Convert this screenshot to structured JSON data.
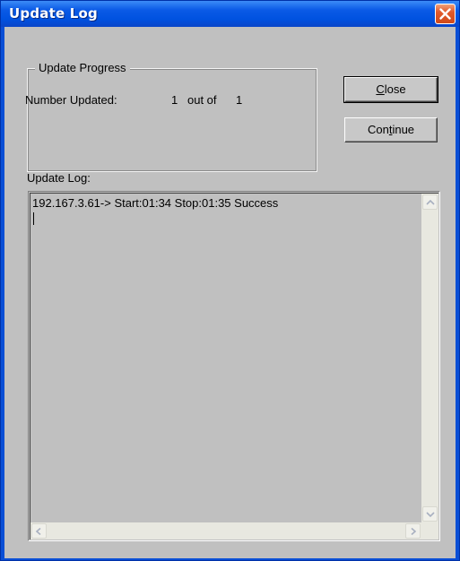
{
  "window": {
    "title": "Update Log"
  },
  "progress": {
    "group_label": "Update Progress",
    "number_label": "Number Updated:",
    "updated": "1",
    "separator": "out of",
    "total": "1"
  },
  "buttons": {
    "close_label": "Close",
    "close_mnemonic": "C",
    "continue_label": "Continue",
    "continue_prefix": "Con",
    "continue_mnemonic": "t",
    "continue_suffix": "inue"
  },
  "log": {
    "label": "Update Log:",
    "lines": [
      "192.167.3.61-> Start:01:34 Stop:01:35  Success"
    ]
  },
  "icons": {
    "close": "close-x-icon",
    "scroll_up": "chevron-up-icon",
    "scroll_down": "chevron-down-icon",
    "scroll_left": "chevron-left-icon",
    "scroll_right": "chevron-right-icon"
  },
  "colors": {
    "titlebar": "#0052e0",
    "close_button": "#e25a2b",
    "client_bg": "#c0c0c0"
  }
}
